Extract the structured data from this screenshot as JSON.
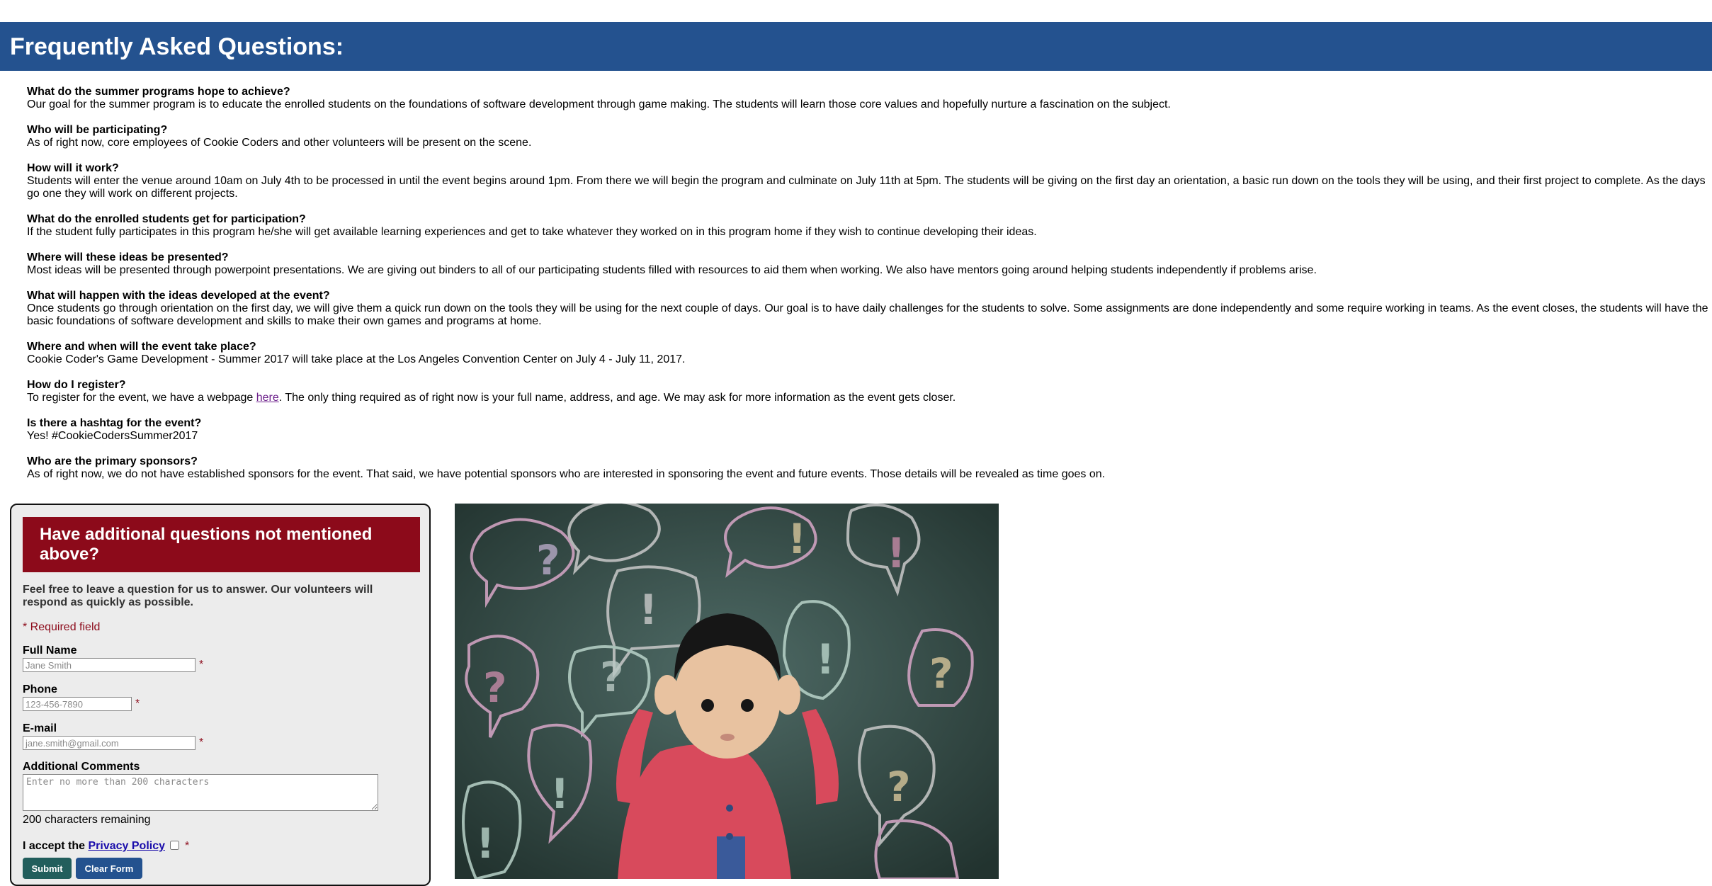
{
  "header": {
    "title": "Frequently Asked Questions:"
  },
  "faq": [
    {
      "q": "What do the summer programs hope to achieve?",
      "a": "Our goal for the summer program is to educate the enrolled students on the foundations of software development through game making. The students will learn those core values and hopefully nurture a fascination on the subject."
    },
    {
      "q": "Who will be participating?",
      "a": "As of right now, core employees of Cookie Coders and other volunteers will be present on the scene."
    },
    {
      "q": "How will it work?",
      "a": "Students will enter the venue around 10am on July 4th to be processed in until the event begins around 1pm. From there we will begin the program and culminate on July 11th at 5pm. The students will be giving on the first day an orientation, a basic run down on the tools they will be using, and their first project to complete. As the days go one they will work on different projects."
    },
    {
      "q": "What do the enrolled students get for participation?",
      "a": "If the student fully participates in this program he/she will get available learning experiences and get to take whatever they worked on in this program home if they wish to continue developing their ideas."
    },
    {
      "q": "Where will these ideas be presented?",
      "a": "Most ideas will be presented through powerpoint presentations. We are giving out binders to all of our participating students filled with resources to aid them when working. We also have mentors going around helping students independently if problems arise."
    },
    {
      "q": "What will happen with the ideas developed at the event?",
      "a": "Once students go through orientation on the first day, we will give them a quick run down on the tools they will be using for the next couple of days. Our goal is to have daily challenges for the students to solve. Some assignments are done independently and some require working in teams. As the event closes, the students will have the basic foundations of software development and skills to make their own games and programs at home."
    },
    {
      "q": "Where and when will the event take place?",
      "a": "Cookie Coder's Game Development - Summer 2017 will take place at the Los Angeles Convention Center on July 4 - July 11, 2017."
    },
    {
      "q": "How do I register?",
      "a_before": "To register for the event, we have a webpage ",
      "a_link": "here",
      "a_after": ". The only thing required as of right now is your full name, address, and age. We may ask for more information as the event gets closer."
    },
    {
      "q": "Is there a hashtag for the event?",
      "a": "Yes! #CookieCodersSummer2017"
    },
    {
      "q": "Who are the primary sponsors?",
      "a": "As of right now, we do not have established sponsors for the event. That said, we have potential sponsors who are interested in sponsoring the event and future events. Those details will be revealed as time goes on."
    }
  ],
  "form": {
    "title": "Have additional questions not mentioned above?",
    "intro": "Feel free to leave a question for us to answer. Our volunteers will respond as quickly as possible.",
    "required_note": "* Required field",
    "star": "*",
    "full_name": {
      "label": "Full Name",
      "placeholder": "Jane Smith"
    },
    "phone": {
      "label": "Phone",
      "placeholder": "123-456-7890"
    },
    "email": {
      "label": "E-mail",
      "placeholder": "jane.smith@gmail.com"
    },
    "comments": {
      "label": "Additional Comments",
      "placeholder": "Enter no more than 200 characters"
    },
    "remaining": "200 characters remaining",
    "accept_prefix": "I accept the ",
    "privacy_link": "Privacy Policy",
    "submit_label": "Submit",
    "clear_label": "Clear Form"
  },
  "colors": {
    "header_blue": "#24528f",
    "form_title_red": "#8c0a1a",
    "submit_green": "#225e5c",
    "clear_blue": "#24528f"
  }
}
